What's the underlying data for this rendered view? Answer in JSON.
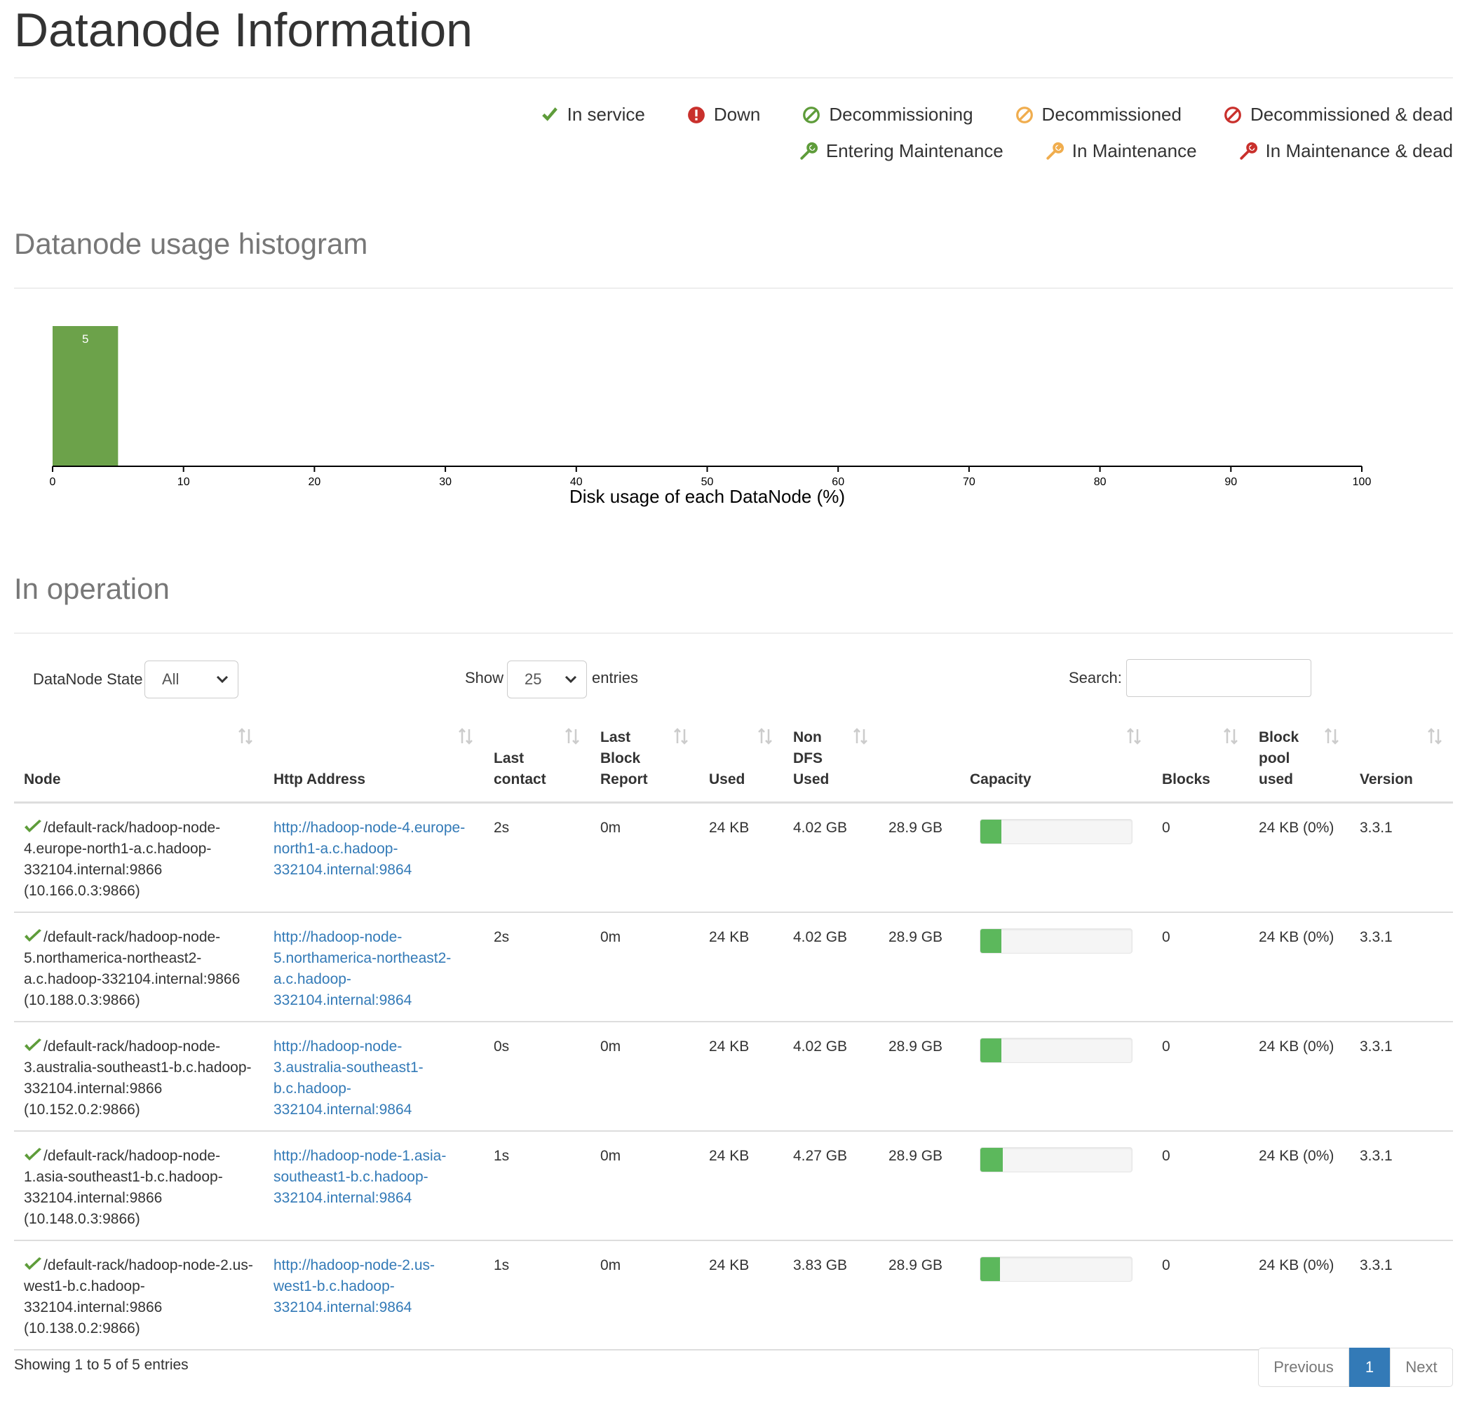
{
  "page": {
    "title": "Datanode Information"
  },
  "legend": {
    "in_service": "In service",
    "down": "Down",
    "decommissioning": "Decommissioning",
    "decommissioned": "Decommissioned",
    "decommissioned_dead": "Decommissioned & dead",
    "entering_maintenance": "Entering Maintenance",
    "in_maintenance": "In Maintenance",
    "in_maintenance_dead": "In Maintenance & dead",
    "colors": {
      "green": "#5e9c3a",
      "red": "#c9302c",
      "orange": "#f0ad4e"
    }
  },
  "histogram_section": {
    "title": "Datanode usage histogram"
  },
  "chart_data": {
    "type": "bar",
    "bins": [
      {
        "x0": 0,
        "x1": 5,
        "count": 5
      }
    ],
    "bar_labels": [
      "5"
    ],
    "xlim": [
      0,
      100
    ],
    "xticks": [
      0,
      10,
      20,
      30,
      40,
      50,
      60,
      70,
      80,
      90,
      100
    ],
    "xlabel": "Disk usage of each DataNode (%)",
    "bar_color": "#6ca24a",
    "grid": false
  },
  "operation_section": {
    "title": "In operation",
    "state_label": "DataNode State",
    "state_value": "All",
    "show_label": "Show",
    "show_value": "25",
    "entries_label": "entries",
    "search_label": "Search:"
  },
  "table": {
    "headers": {
      "node": "Node",
      "http": "Http Address",
      "last_contact": "Last contact",
      "last_block_report": "Last Block Report",
      "used": "Used",
      "non_dfs_used": "Non DFS Used",
      "capacity": "Capacity",
      "blocks": "Blocks",
      "block_pool_used": "Block pool used",
      "version": "Version"
    },
    "rows": [
      {
        "node": "/default-rack/hadoop-node-4.europe-north1-a.c.hadoop-332104.internal:9866 (10.166.0.3:9866)",
        "http": "http://hadoop-node-4.europe-north1-a.c.hadoop-332104.internal:9864",
        "last_contact": "2s",
        "last_block_report": "0m",
        "used": "24 KB",
        "non_dfs_used": "4.02 GB",
        "capacity_text": "28.9 GB",
        "capacity_pct": 14,
        "blocks": "0",
        "block_pool_used": "24 KB (0%)",
        "version": "3.3.1"
      },
      {
        "node": "/default-rack/hadoop-node-5.northamerica-northeast2-a.c.hadoop-332104.internal:9866 (10.188.0.3:9866)",
        "http": "http://hadoop-node-5.northamerica-northeast2-a.c.hadoop-332104.internal:9864",
        "last_contact": "2s",
        "last_block_report": "0m",
        "used": "24 KB",
        "non_dfs_used": "4.02 GB",
        "capacity_text": "28.9 GB",
        "capacity_pct": 14,
        "blocks": "0",
        "block_pool_used": "24 KB (0%)",
        "version": "3.3.1"
      },
      {
        "node": "/default-rack/hadoop-node-3.australia-southeast1-b.c.hadoop-332104.internal:9866 (10.152.0.2:9866)",
        "http": "http://hadoop-node-3.australia-southeast1-b.c.hadoop-332104.internal:9864",
        "last_contact": "0s",
        "last_block_report": "0m",
        "used": "24 KB",
        "non_dfs_used": "4.02 GB",
        "capacity_text": "28.9 GB",
        "capacity_pct": 14,
        "blocks": "0",
        "block_pool_used": "24 KB (0%)",
        "version": "3.3.1"
      },
      {
        "node": "/default-rack/hadoop-node-1.asia-southeast1-b.c.hadoop-332104.internal:9866 (10.148.0.3:9866)",
        "http": "http://hadoop-node-1.asia-southeast1-b.c.hadoop-332104.internal:9864",
        "last_contact": "1s",
        "last_block_report": "0m",
        "used": "24 KB",
        "non_dfs_used": "4.27 GB",
        "capacity_text": "28.9 GB",
        "capacity_pct": 15,
        "blocks": "0",
        "block_pool_used": "24 KB (0%)",
        "version": "3.3.1"
      },
      {
        "node": "/default-rack/hadoop-node-2.us-west1-b.c.hadoop-332104.internal:9866 (10.138.0.2:9866)",
        "http": "http://hadoop-node-2.us-west1-b.c.hadoop-332104.internal:9864",
        "last_contact": "1s",
        "last_block_report": "0m",
        "used": "24 KB",
        "non_dfs_used": "3.83 GB",
        "capacity_text": "28.9 GB",
        "capacity_pct": 13,
        "blocks": "0",
        "block_pool_used": "24 KB (0%)",
        "version": "3.3.1"
      }
    ]
  },
  "footer": {
    "info": "Showing 1 to 5 of 5 entries",
    "previous": "Previous",
    "current_page": "1",
    "next": "Next"
  }
}
